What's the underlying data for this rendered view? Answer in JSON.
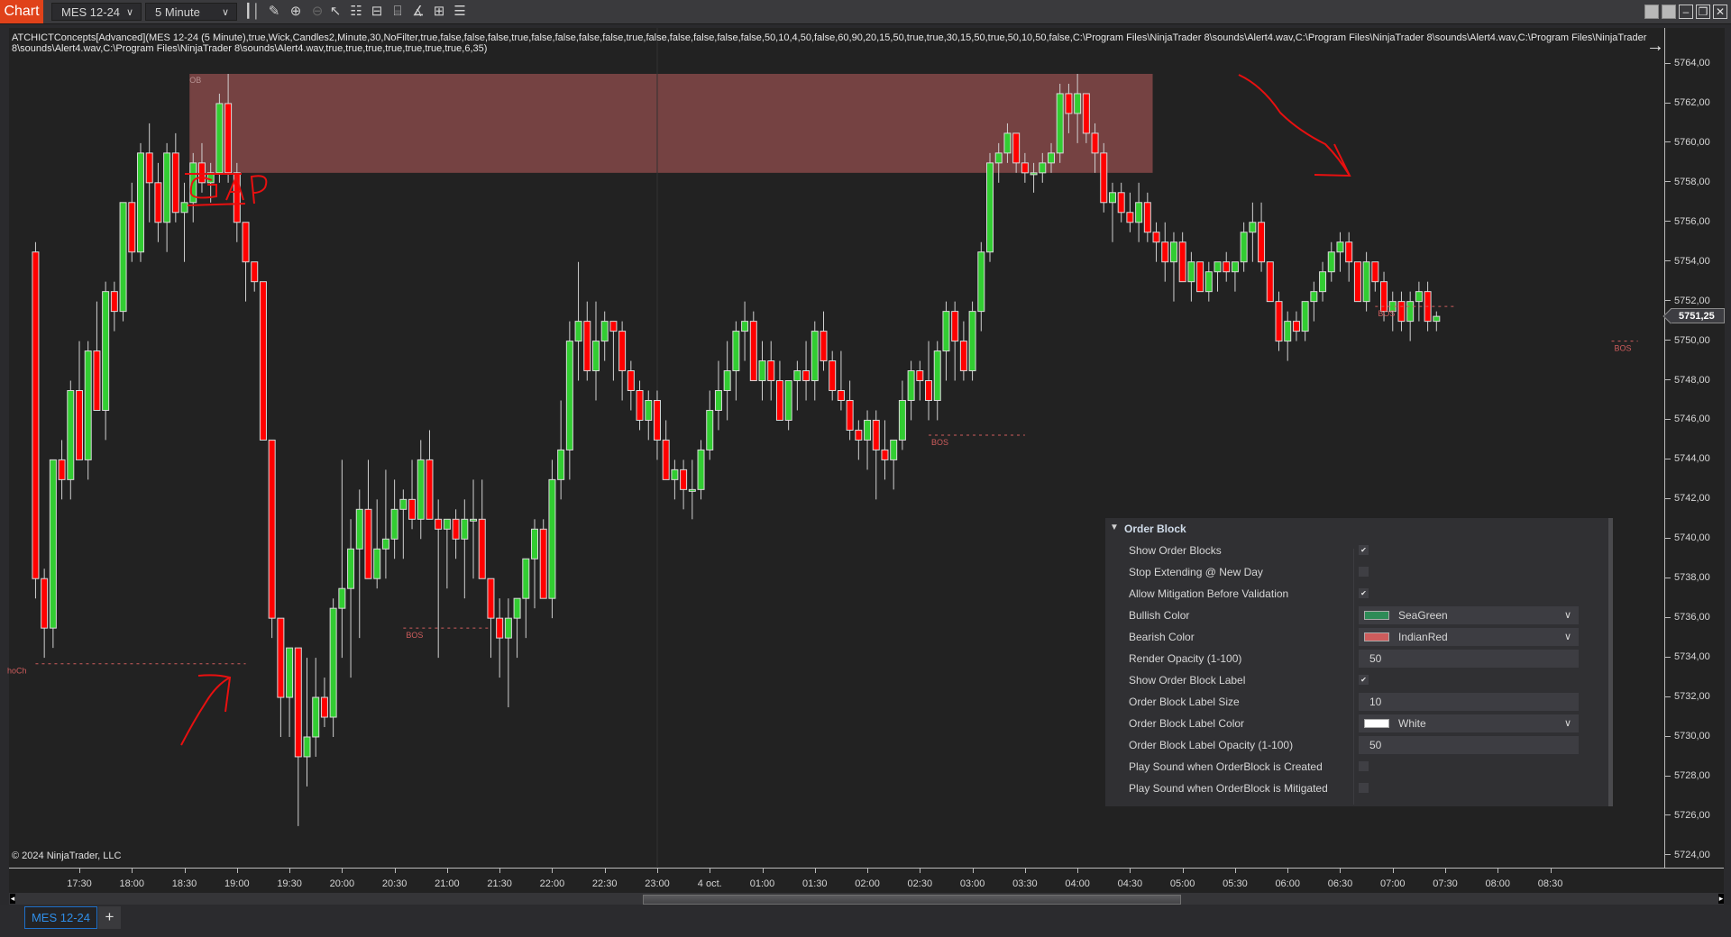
{
  "toolbar": {
    "chart_tab": "Chart",
    "instrument": "MES 12-24",
    "interval": "5 Minute",
    "icons": [
      "bar-type-icon",
      "drawing-tools-icon",
      "zoom-in-icon",
      "zoom-out-icon",
      "pointer-icon",
      "data-box-icon",
      "properties-icon",
      "indicators-icon",
      "strategies-icon",
      "templates-icon",
      "list-icon"
    ]
  },
  "indicator_label": "ATCHICTConcepts[Advanced](MES 12-24 (5 Minute),true,Wick,Candles2,Minute,30,NoFilter,true,false,false,false,true,false,false,false,false,true,false,false,false,false,false,50,10,4,50,false,60,90,20,15,50,true,true,30,15,50,true,50,10,50,false,C:\\Program Files\\NinjaTrader 8\\sounds\\Alert4.wav,C:\\Program Files\\NinjaTrader 8\\sounds\\Alert4.wav,C:\\Program Files\\NinjaTrader 8\\sounds\\Alert4.wav,C:\\Program Files\\NinjaTrader 8\\sounds\\Alert4.wav,true,true,true,true,true,true,true,6,35)",
  "copyright": "© 2024 NinjaTrader, LLC",
  "last_price": "5751,25",
  "bottom": {
    "instrument_tab": "MES 12-24",
    "add_tab": "+"
  },
  "panel": {
    "section": "Order Block",
    "rows": [
      {
        "label": "Show Order Blocks",
        "type": "check",
        "value": true
      },
      {
        "label": "Stop Extending @ New Day",
        "type": "check",
        "value": false
      },
      {
        "label": "Allow Mitigation Before Validation",
        "type": "check",
        "value": true
      },
      {
        "label": "Bullish Color",
        "type": "color",
        "value": "SeaGreen",
        "swatch": "#2e8b57"
      },
      {
        "label": "Bearish Color",
        "type": "color",
        "value": "IndianRed",
        "swatch": "#cd5c5c"
      },
      {
        "label": "Render Opacity (1-100)",
        "type": "text",
        "value": "50"
      },
      {
        "label": "Show Order Block Label",
        "type": "check",
        "value": true
      },
      {
        "label": "Order Block Label Size",
        "type": "text",
        "value": "10"
      },
      {
        "label": "Order Block Label Color",
        "type": "color",
        "value": "White",
        "swatch": "#ffffff"
      },
      {
        "label": "Order Block Label Opacity (1-100)",
        "type": "text",
        "value": "50"
      },
      {
        "label": "Play Sound when OrderBlock is Created",
        "type": "check",
        "value": false
      },
      {
        "label": "Play Sound when OrderBlock is Mitigated",
        "type": "check",
        "value": false
      }
    ]
  },
  "colors": {
    "up": "#32cd32",
    "down": "#ff0000",
    "wick": "#d0d0d0",
    "ob_zone": "#7a4444",
    "annotation": "#e81010",
    "bos": "#cd5c5c"
  },
  "chart_data": {
    "type": "candlestick",
    "title": "MES 12-24 (5 Minute)",
    "ylim": [
      5723,
      5766
    ],
    "y_ticks": [
      "5764,00",
      "5762,00",
      "5760,00",
      "5758,00",
      "5756,00",
      "5754,00",
      "5752,00",
      "5750,00",
      "5748,00",
      "5746,00",
      "5744,00",
      "5742,00",
      "5740,00",
      "5738,00",
      "5736,00",
      "5734,00",
      "5732,00",
      "5730,00",
      "5728,00",
      "5726,00",
      "5724,00"
    ],
    "x_ticks": [
      "17:30",
      "18:00",
      "18:30",
      "19:00",
      "19:30",
      "20:00",
      "20:30",
      "21:00",
      "21:30",
      "22:00",
      "22:30",
      "23:00",
      "4 oct.",
      "01:00",
      "01:30",
      "02:00",
      "02:30",
      "03:00",
      "03:30",
      "04:00",
      "04:30",
      "05:00",
      "05:30",
      "06:00",
      "06:30",
      "07:00",
      "07:30",
      "08:00",
      "08:30"
    ],
    "start_time": "17:05",
    "bar_minutes": 5,
    "candles": [
      [
        5754.5,
        5755,
        5737,
        5738
      ],
      [
        5738,
        5738.5,
        5734,
        5735.5
      ],
      [
        5735.5,
        5744,
        5734.5,
        5744
      ],
      [
        5744,
        5745,
        5742,
        5743
      ],
      [
        5743,
        5748,
        5742,
        5747.5
      ],
      [
        5747.5,
        5750,
        5744,
        5744
      ],
      [
        5744,
        5750,
        5743,
        5749.5
      ],
      [
        5749.5,
        5752,
        5747,
        5746.5
      ],
      [
        5746.5,
        5753,
        5745,
        5752.5
      ],
      [
        5752.5,
        5753,
        5750.5,
        5751.5
      ],
      [
        5751.5,
        5757,
        5751,
        5757
      ],
      [
        5757,
        5758,
        5754,
        5754.5
      ],
      [
        5754.5,
        5760,
        5754,
        5759.5
      ],
      [
        5759.5,
        5761,
        5756,
        5758
      ],
      [
        5758,
        5759,
        5755,
        5756
      ],
      [
        5756,
        5760,
        5754.5,
        5759.5
      ],
      [
        5759.5,
        5760.5,
        5756,
        5756.5
      ],
      [
        5756.5,
        5758,
        5754,
        5757
      ],
      [
        5757,
        5759.5,
        5756,
        5759
      ],
      [
        5759,
        5760,
        5757.5,
        5758
      ],
      [
        5758,
        5759,
        5757,
        5758.5
      ],
      [
        5758.5,
        5762.5,
        5758,
        5762
      ],
      [
        5762,
        5763.5,
        5758,
        5758.5
      ],
      [
        5758.5,
        5759,
        5755,
        5756
      ],
      [
        5756,
        5756,
        5752,
        5754
      ],
      [
        5754,
        5754,
        5752.5,
        5753
      ],
      [
        5753,
        5753,
        5745,
        5745
      ],
      [
        5745,
        5745,
        5735,
        5736
      ],
      [
        5736,
        5736,
        5730,
        5732
      ],
      [
        5732,
        5734.5,
        5730,
        5734.5
      ],
      [
        5734.5,
        5734.5,
        5725.5,
        5729
      ],
      [
        5729,
        5734,
        5727.5,
        5730
      ],
      [
        5730,
        5734,
        5729,
        5732
      ],
      [
        5732,
        5733,
        5730.5,
        5731
      ],
      [
        5731,
        5737,
        5730,
        5736.5
      ],
      [
        5736.5,
        5744,
        5734,
        5737.5
      ],
      [
        5737.5,
        5741,
        5733,
        5739.5
      ],
      [
        5739.5,
        5742.5,
        5735,
        5741.5
      ],
      [
        5741.5,
        5744,
        5738,
        5738
      ],
      [
        5738,
        5742,
        5737.5,
        5739.5
      ],
      [
        5739.5,
        5743.5,
        5738,
        5740
      ],
      [
        5740,
        5743,
        5739,
        5741.5
      ],
      [
        5741.5,
        5742.5,
        5739,
        5742
      ],
      [
        5742,
        5744,
        5740.5,
        5741
      ],
      [
        5741,
        5745,
        5740,
        5744
      ],
      [
        5744,
        5745.5,
        5741,
        5741
      ],
      [
        5741,
        5742,
        5734,
        5740.5
      ],
      [
        5740.5,
        5741,
        5737.5,
        5741
      ],
      [
        5741,
        5741.5,
        5739,
        5740
      ],
      [
        5740,
        5742,
        5737,
        5741
      ],
      [
        5741,
        5743,
        5738,
        5741
      ],
      [
        5741,
        5743,
        5738,
        5738
      ],
      [
        5738,
        5738,
        5734,
        5736
      ],
      [
        5736,
        5737,
        5733,
        5735
      ],
      [
        5735,
        5737,
        5731.5,
        5736
      ],
      [
        5736,
        5737,
        5734,
        5737
      ],
      [
        5737,
        5739,
        5735,
        5739
      ],
      [
        5739,
        5741,
        5736.5,
        5740.5
      ],
      [
        5740.5,
        5741,
        5737,
        5737
      ],
      [
        5737,
        5744,
        5736,
        5743
      ],
      [
        5743,
        5747,
        5742,
        5744.5
      ],
      [
        5744.5,
        5751,
        5743,
        5750
      ],
      [
        5750,
        5754,
        5748,
        5751
      ],
      [
        5751,
        5752,
        5748,
        5748.5
      ],
      [
        5748.5,
        5752,
        5747,
        5750
      ],
      [
        5750,
        5751.5,
        5749,
        5751
      ],
      [
        5751,
        5751,
        5748,
        5750.5
      ],
      [
        5750.5,
        5751,
        5747,
        5748.5
      ],
      [
        5748.5,
        5749,
        5746.5,
        5747.5
      ],
      [
        5747.5,
        5748,
        5745.5,
        5746
      ],
      [
        5746,
        5747.5,
        5745,
        5747
      ],
      [
        5747,
        5747.5,
        5744,
        5745
      ],
      [
        5745,
        5746,
        5743,
        5743
      ],
      [
        5743,
        5744,
        5742,
        5743.5
      ],
      [
        5743.5,
        5744,
        5741.5,
        5742.5
      ],
      [
        5742.5,
        5744,
        5741,
        5742.5
      ],
      [
        5742.5,
        5745,
        5742,
        5744.5
      ],
      [
        5744.5,
        5747.5,
        5744,
        5746.5
      ],
      [
        5746.5,
        5749,
        5745.5,
        5747.5
      ],
      [
        5747.5,
        5750,
        5746,
        5748.5
      ],
      [
        5748.5,
        5751,
        5747,
        5750.5
      ],
      [
        5750.5,
        5752,
        5749,
        5751
      ],
      [
        5751,
        5751.5,
        5748,
        5748
      ],
      [
        5748,
        5750,
        5747,
        5749
      ],
      [
        5749,
        5750,
        5747,
        5748
      ],
      [
        5748,
        5749,
        5746,
        5746
      ],
      [
        5746,
        5748,
        5745.5,
        5748
      ],
      [
        5748,
        5749,
        5746.5,
        5748.5
      ],
      [
        5748.5,
        5750,
        5747,
        5748
      ],
      [
        5748,
        5751,
        5747,
        5750.5
      ],
      [
        5750.5,
        5751.5,
        5748.5,
        5749
      ],
      [
        5749,
        5749.5,
        5747,
        5747.5
      ],
      [
        5747.5,
        5749.5,
        5746.5,
        5747
      ],
      [
        5747,
        5748,
        5745,
        5745.5
      ],
      [
        5745.5,
        5746,
        5744,
        5745
      ],
      [
        5745,
        5746.5,
        5743.5,
        5746
      ],
      [
        5746,
        5746.5,
        5742,
        5744.5
      ],
      [
        5744.5,
        5746,
        5743,
        5744
      ],
      [
        5744,
        5745,
        5742.5,
        5745
      ],
      [
        5745,
        5748,
        5744.5,
        5747
      ],
      [
        5747,
        5749,
        5746,
        5748.5
      ],
      [
        5748.5,
        5749,
        5747,
        5748
      ],
      [
        5748,
        5750,
        5746,
        5747
      ],
      [
        5747,
        5750,
        5746,
        5749.5
      ],
      [
        5749.5,
        5752,
        5748,
        5751.5
      ],
      [
        5751.5,
        5752,
        5748,
        5750
      ],
      [
        5750,
        5751,
        5748,
        5748.5
      ],
      [
        5748.5,
        5752,
        5748,
        5751.5
      ],
      [
        5751.5,
        5755,
        5750.5,
        5754.5
      ],
      [
        5754.5,
        5759.5,
        5754,
        5759
      ],
      [
        5759,
        5760,
        5758,
        5759.5
      ],
      [
        5759.5,
        5761,
        5759,
        5760.5
      ],
      [
        5760.5,
        5760.5,
        5758.5,
        5759
      ],
      [
        5759,
        5759.5,
        5758,
        5758.5
      ],
      [
        5758.5,
        5759,
        5757.5,
        5758.5
      ],
      [
        5758.5,
        5759.5,
        5758,
        5759
      ],
      [
        5759,
        5760,
        5758.5,
        5759.5
      ],
      [
        5759.5,
        5763,
        5759,
        5762.5
      ],
      [
        5762.5,
        5763,
        5760.5,
        5761.5
      ],
      [
        5761.5,
        5763.5,
        5760,
        5762.5
      ],
      [
        5762.5,
        5762.5,
        5760,
        5760.5
      ],
      [
        5760.5,
        5761,
        5758.5,
        5759.5
      ],
      [
        5759.5,
        5760,
        5756.5,
        5757
      ],
      [
        5757,
        5758,
        5755,
        5757.5
      ],
      [
        5757.5,
        5758,
        5756,
        5756.5
      ],
      [
        5756.5,
        5757.5,
        5755.5,
        5756
      ],
      [
        5756,
        5758,
        5755,
        5757
      ],
      [
        5757,
        5757.5,
        5755,
        5755.5
      ],
      [
        5755.5,
        5756,
        5754,
        5755
      ],
      [
        5755,
        5756,
        5753,
        5754
      ],
      [
        5754,
        5755.5,
        5752,
        5755
      ],
      [
        5755,
        5755.5,
        5753,
        5753
      ],
      [
        5753,
        5754.5,
        5752,
        5754
      ],
      [
        5754,
        5754,
        5752.5,
        5752.5
      ],
      [
        5752.5,
        5754,
        5752,
        5753.5
      ],
      [
        5753.5,
        5754,
        5752.5,
        5754
      ],
      [
        5754,
        5754.5,
        5753,
        5753.5
      ],
      [
        5753.5,
        5754,
        5752.5,
        5754
      ],
      [
        5754,
        5756,
        5753.5,
        5755.5
      ],
      [
        5755.5,
        5757,
        5754,
        5756
      ],
      [
        5756,
        5757,
        5753.5,
        5754
      ],
      [
        5754,
        5754,
        5752,
        5752
      ],
      [
        5752,
        5752.5,
        5749.5,
        5750
      ],
      [
        5750,
        5751.5,
        5749,
        5751
      ],
      [
        5751,
        5751.5,
        5750,
        5750.5
      ],
      [
        5750.5,
        5752,
        5750,
        5752
      ],
      [
        5752,
        5753,
        5751,
        5752.5
      ],
      [
        5752.5,
        5754,
        5752,
        5753.5
      ],
      [
        5753.5,
        5755,
        5753,
        5754.5
      ],
      [
        5754.5,
        5755.5,
        5753.5,
        5755
      ],
      [
        5755,
        5755.5,
        5753,
        5754
      ],
      [
        5754,
        5754,
        5752,
        5752
      ],
      [
        5752,
        5754.5,
        5751.5,
        5754
      ],
      [
        5754,
        5754,
        5752.5,
        5753
      ],
      [
        5753,
        5753.5,
        5751,
        5751.5
      ],
      [
        5751.5,
        5752.5,
        5750.5,
        5752
      ],
      [
        5752,
        5752.5,
        5750.5,
        5751
      ],
      [
        5751,
        5752.5,
        5750,
        5752
      ],
      [
        5752,
        5753,
        5751,
        5752.5
      ],
      [
        5752.5,
        5753,
        5750.5,
        5751
      ],
      [
        5751,
        5751.5,
        5750.5,
        5751.25
      ]
    ],
    "order_block": {
      "label": "OB",
      "high": 5763.5,
      "low": 5758.5,
      "start_time": "18:35",
      "end_time": "03:45"
    },
    "structure_lines": [
      {
        "label": "hoCh",
        "price": 5733.7,
        "start_time": "17:05",
        "end_time": "19:05"
      },
      {
        "label": "BOS",
        "price": 5735.5,
        "start_time": "20:35",
        "end_time": "21:25"
      },
      {
        "label": "BOS",
        "price": 5745.25,
        "start_time": "01:35",
        "end_time": "02:30"
      },
      {
        "label": "BOS",
        "price": 5751.75,
        "start_time": "05:50",
        "end_time": "06:35"
      },
      {
        "label": "BOS",
        "price": 5750.0,
        "start_time": "08:05",
        "end_time": "08:20"
      }
    ],
    "annotations": [
      {
        "text": "GAP"
      },
      {
        "text": "arrow-up-right"
      },
      {
        "text": "arrow-down-right"
      }
    ]
  }
}
